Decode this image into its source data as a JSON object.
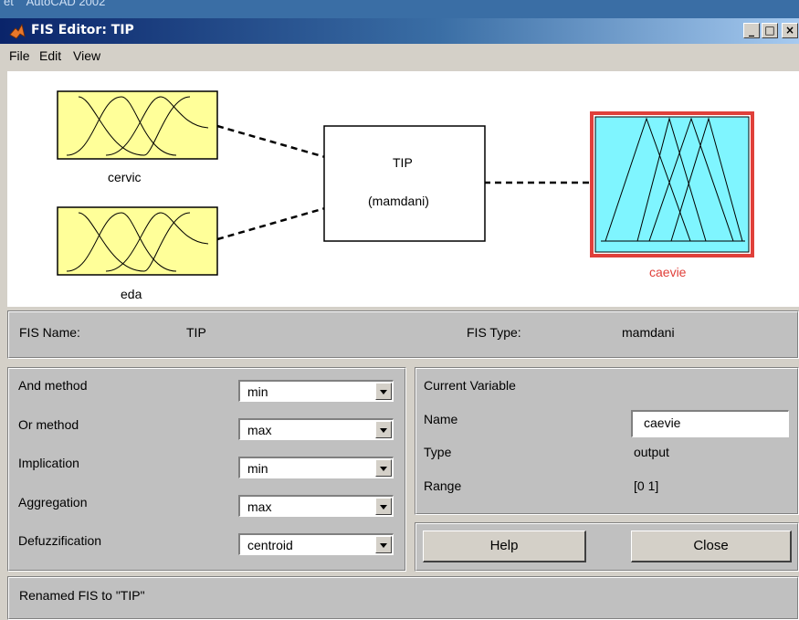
{
  "background_window": {
    "title": "et    AutoCAD 2002"
  },
  "window": {
    "title": "FIS Editor: TIP",
    "controls": {
      "minimize": "_",
      "maximize": "□",
      "close": "×"
    }
  },
  "menu": [
    "File",
    "Edit",
    "View"
  ],
  "diagram": {
    "inputs": [
      {
        "name": "cervic"
      },
      {
        "name": "eda"
      }
    ],
    "system": {
      "name": "TIP",
      "type": "(mamdani)"
    },
    "output": {
      "name": "caevie",
      "selected": true
    },
    "colors": {
      "input_fill": "#ffff99",
      "output_fill": "#7ff5ff",
      "selection": "#e0403a"
    }
  },
  "fis_info": {
    "name_label": "FIS Name:",
    "name_value": "TIP",
    "type_label": "FIS Type:",
    "type_value": "mamdani"
  },
  "methods": [
    {
      "label": "And method",
      "value": "min"
    },
    {
      "label": "Or method",
      "value": "max"
    },
    {
      "label": "Implication",
      "value": "min"
    },
    {
      "label": "Aggregation",
      "value": "max"
    },
    {
      "label": "Defuzzification",
      "value": "centroid"
    }
  ],
  "current_variable": {
    "heading": "Current Variable",
    "name_label": "Name",
    "name_value": "caevie",
    "type_label": "Type",
    "type_value": "output",
    "range_label": "Range",
    "range_value": "[0 1]"
  },
  "buttons": {
    "help": "Help",
    "close": "Close"
  },
  "status": "Renamed FIS to \"TIP\""
}
